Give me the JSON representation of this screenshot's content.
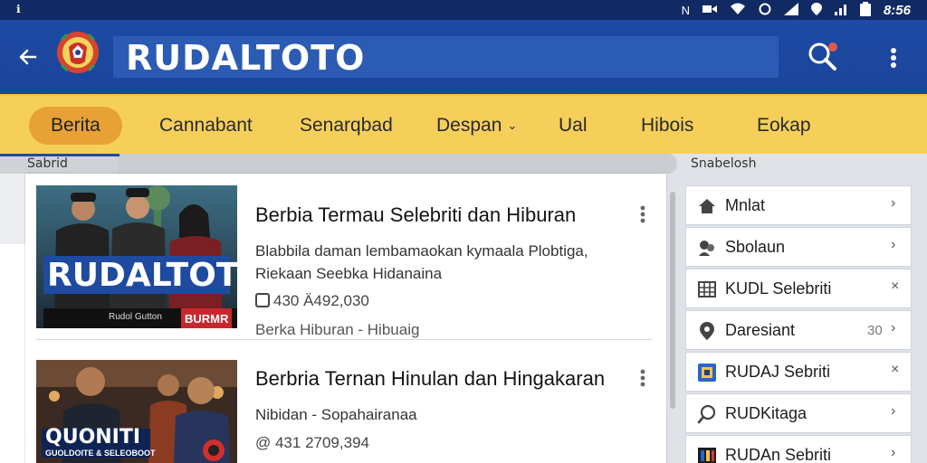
{
  "statusbar": {
    "left": "ℹ︎",
    "time": "8:56"
  },
  "appbar": {
    "title": "RUDALTOTO"
  },
  "tabs": [
    {
      "label": "Berita",
      "active": true
    },
    {
      "label": "Cannabant"
    },
    {
      "label": "Senarqbad"
    },
    {
      "label": "Despan",
      "dropdown": true
    },
    {
      "label": "Ual"
    },
    {
      "label": "Hibois"
    },
    {
      "label": "Eokap"
    }
  ],
  "sections": {
    "left_label": "Sabrid",
    "right_label": "Snabelosh"
  },
  "feed": {
    "items": [
      {
        "thumb_title": "RUDALTOTO",
        "thumb_caption": "Rudol Gutton",
        "thumb_badge": "BURMR",
        "title": "Berbia Termau Selebriti dan Hiburan",
        "desc": "Blabbila daman lembamaokan kymaala Plobtiga, Riekaan Seebka Hidanaina",
        "meta": "430 Ä492,030",
        "sub": "Berka Hiburan - Hibuaig"
      },
      {
        "thumb_title": "QUONITI",
        "thumb_caption": "GUOLDOITE & SELEOBOOT",
        "title": "Berbria Ternan Hinulan dan Hingakaran",
        "desc": "Nibidan - Sopahairanaa",
        "meta": "@ 431 2709,394",
        "sub": ""
      }
    ]
  },
  "right_list": [
    {
      "label": "Mnlat",
      "icon": "home-icon",
      "arrow": "›"
    },
    {
      "label": "Sbolaun",
      "icon": "people-icon",
      "arrow": "›"
    },
    {
      "label": "KUDL Selebriti",
      "icon": "grid-icon",
      "arrow": "×"
    },
    {
      "label": "Daresiant",
      "icon": "location-icon",
      "count": "30",
      "arrow": "›"
    },
    {
      "label": "RUDAJ Sebriti",
      "icon": "app-icon",
      "arrow": "×"
    },
    {
      "label": "RUDKitaga",
      "icon": "search-icon",
      "arrow": "›"
    },
    {
      "label": "RUDAn Sebriti",
      "icon": "film-icon",
      "arrow": "›"
    }
  ],
  "colors": {
    "statusbar": "#122a63",
    "appbar": "#1d4aa3",
    "tabbar": "#f6cf5b",
    "active_tab": "#e8a135"
  }
}
